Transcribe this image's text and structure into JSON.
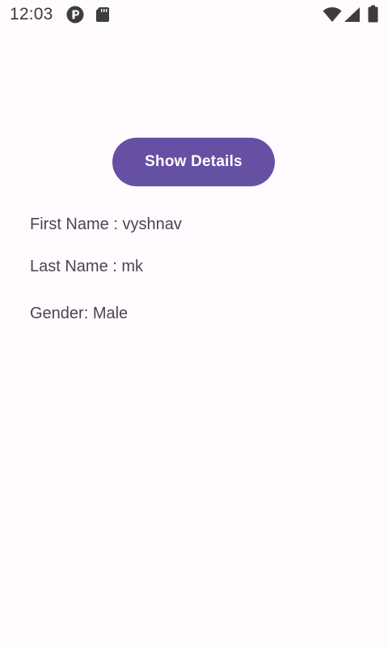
{
  "status_bar": {
    "time": "12:03",
    "icons": [
      "notification-p-icon",
      "sd-card-icon",
      "wifi-icon",
      "signal-icon",
      "battery-icon"
    ]
  },
  "main": {
    "button_label": "Show Details",
    "first_name_line": "First Name : vyshnav",
    "last_name_line": "Last Name : mk",
    "gender_line": "Gender: Male"
  },
  "colors": {
    "accent": "#6650A4",
    "background": "#FFFBFE",
    "text": "#4A454F"
  }
}
